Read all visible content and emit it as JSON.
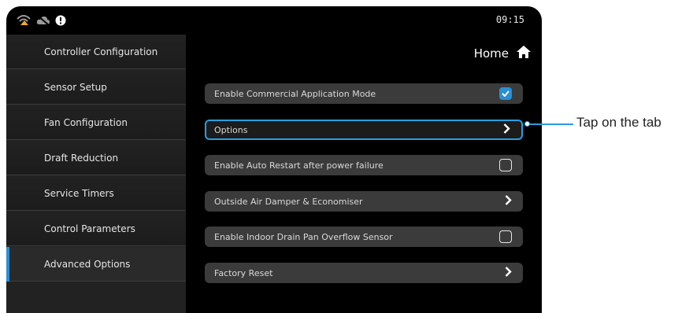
{
  "status": {
    "time": "09:15",
    "icons": [
      "wifi-warning-icon",
      "cloud-off-icon",
      "alert-info-icon"
    ]
  },
  "header": {
    "home_label": "Home",
    "home_icon": "home-icon"
  },
  "sidebar": {
    "items": [
      {
        "label": "Controller Configuration"
      },
      {
        "label": "Sensor Setup"
      },
      {
        "label": "Fan Configuration"
      },
      {
        "label": "Draft Reduction"
      },
      {
        "label": "Service Timers"
      },
      {
        "label": "Control Parameters"
      },
      {
        "label": "Advanced Options",
        "active": true
      }
    ]
  },
  "options": [
    {
      "label": "Enable Commercial Application Mode",
      "control": "checkbox",
      "checked": true
    },
    {
      "label": "Options",
      "control": "chevron",
      "highlighted": true
    },
    {
      "label": "Enable Auto Restart after power failure",
      "control": "checkbox",
      "checked": false
    },
    {
      "label": "Outside Air Damper & Economiser",
      "control": "chevron"
    },
    {
      "label": "Enable Indoor Drain Pan Overflow Sensor",
      "control": "checkbox",
      "checked": false
    },
    {
      "label": "Factory Reset",
      "control": "chevron"
    }
  ],
  "annotation": {
    "text": "Tap on the tab"
  },
  "colors": {
    "accent": "#2a9de2",
    "panel": "#3b3b3b",
    "sidebar": "#222222",
    "background": "#000000"
  }
}
